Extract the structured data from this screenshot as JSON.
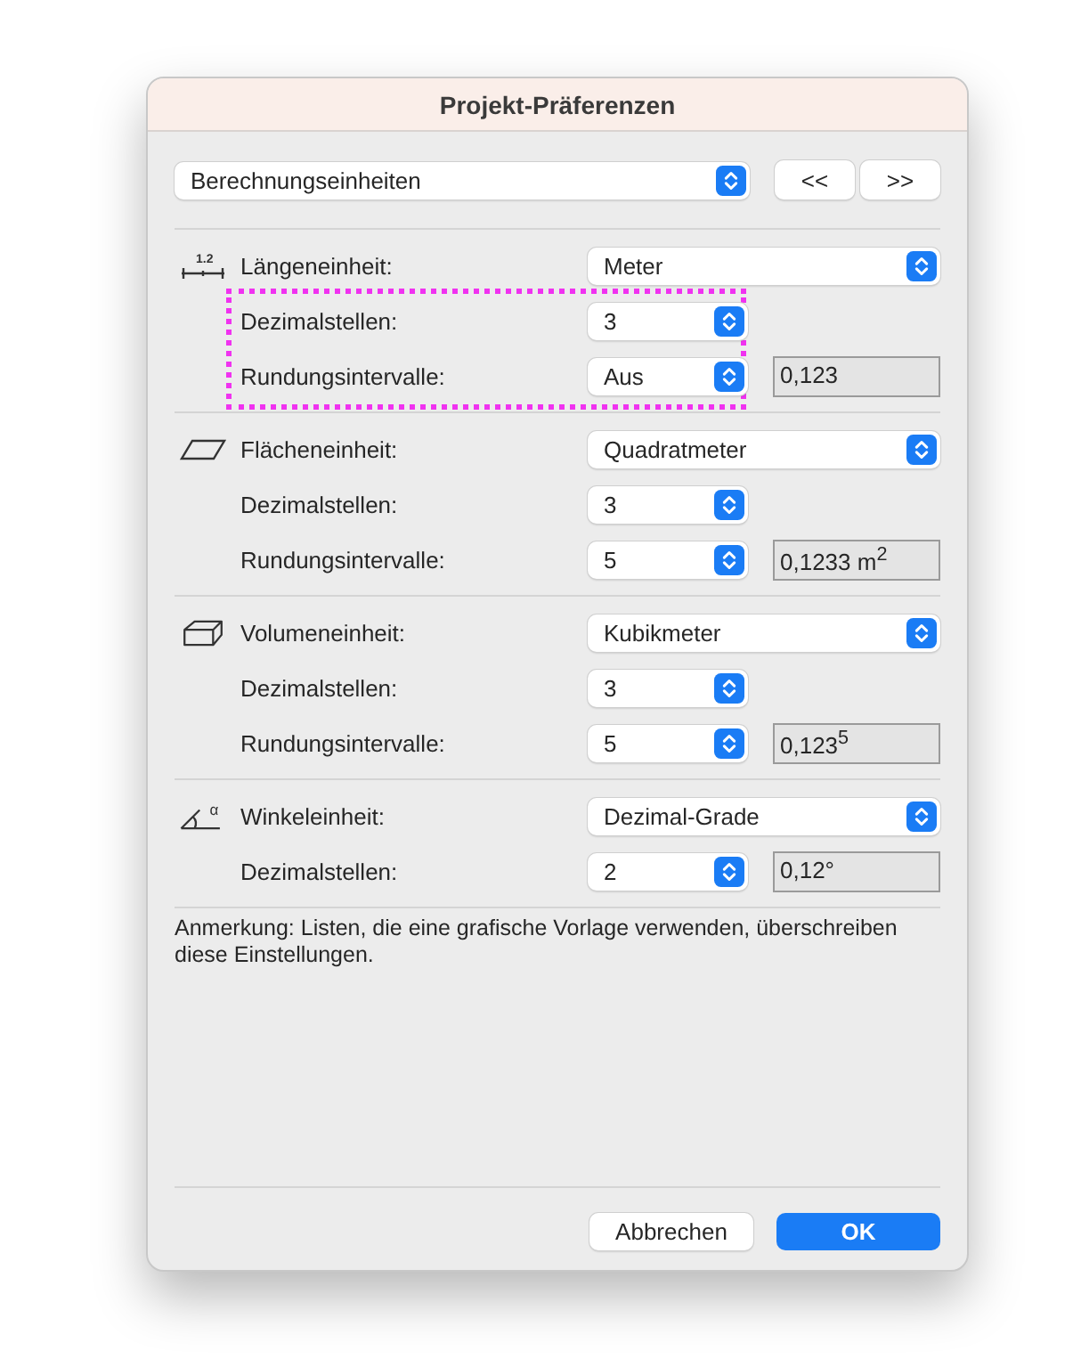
{
  "window": {
    "title": "Projekt-Präferenzen"
  },
  "page_select": {
    "value": "Berechnungseinheiten"
  },
  "nav_buttons": [
    "<<",
    ">>"
  ],
  "sections": [
    {
      "kind": "length",
      "icon_text": "1.2",
      "label": "Längeneinheit:",
      "value": "Meter",
      "highlighted": true,
      "rows": [
        {
          "label": "Dezimalstellen:",
          "value": "3"
        },
        {
          "label": "Rundungsintervalle:",
          "value": "Aus",
          "preview": "0,123"
        }
      ]
    },
    {
      "kind": "area",
      "label": "Flächeneinheit:",
      "value": "Quadratmeter",
      "highlighted": false,
      "rows": [
        {
          "label": "Dezimalstellen:",
          "value": "3"
        },
        {
          "label": "Rundungsintervalle:",
          "value": "5",
          "preview": "0,1233 m$^{2}$"
        }
      ]
    },
    {
      "kind": "volume",
      "label": "Volumeneinheit:",
      "value": "Kubikmeter",
      "highlighted": false,
      "rows": [
        {
          "label": "Dezimalstellen:",
          "value": "3"
        },
        {
          "label": "Rundungsintervalle:",
          "value": "5",
          "preview": "0,123$^{5}$"
        }
      ]
    },
    {
      "kind": "angle",
      "icon_text": "α",
      "label": "Winkeleinheit:",
      "value": "Dezimal-Grade",
      "highlighted": false,
      "rows": [
        {
          "label": "Dezimalstellen:",
          "value": "2",
          "preview": "0,12°"
        }
      ]
    }
  ],
  "note": "Anmerkung: Listen, die eine grafische Vorlage verwenden, überschreiben diese Einstellungen.",
  "buttons": [
    {
      "label": "Abbrechen",
      "kind": "secondary"
    },
    {
      "label": "OK",
      "kind": "primary"
    }
  ]
}
